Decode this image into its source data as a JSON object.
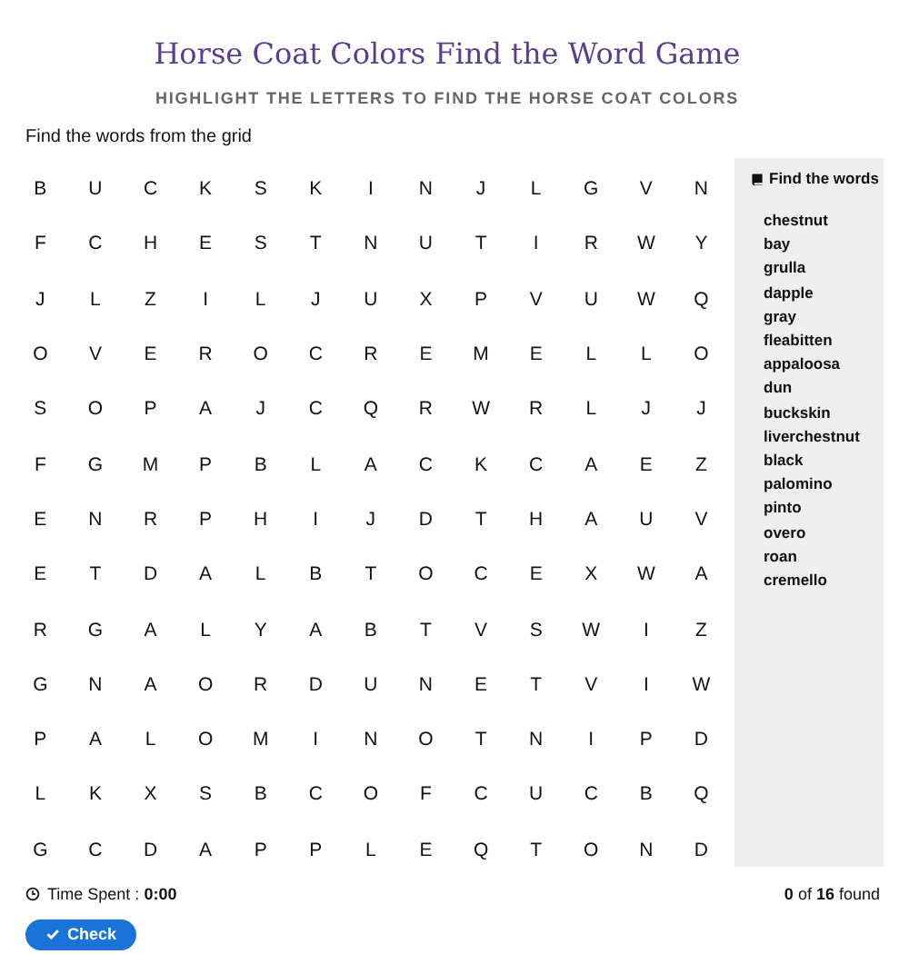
{
  "title": "Horse Coat Colors Find the Word Game",
  "subtitle": "HIGHLIGHT THE LETTERS TO FIND THE HORSE COAT COLORS",
  "instruction": "Find the words from the grid",
  "grid": [
    [
      "B",
      "U",
      "C",
      "K",
      "S",
      "K",
      "I",
      "N",
      "J",
      "L",
      "G",
      "V",
      "N"
    ],
    [
      "F",
      "C",
      "H",
      "E",
      "S",
      "T",
      "N",
      "U",
      "T",
      "I",
      "R",
      "W",
      "Y"
    ],
    [
      "J",
      "L",
      "Z",
      "I",
      "L",
      "J",
      "U",
      "X",
      "P",
      "V",
      "U",
      "W",
      "Q"
    ],
    [
      "O",
      "V",
      "E",
      "R",
      "O",
      "C",
      "R",
      "E",
      "M",
      "E",
      "L",
      "L",
      "O"
    ],
    [
      "S",
      "O",
      "P",
      "A",
      "J",
      "C",
      "Q",
      "R",
      "W",
      "R",
      "L",
      "J",
      "J"
    ],
    [
      "F",
      "G",
      "M",
      "P",
      "B",
      "L",
      "A",
      "C",
      "K",
      "C",
      "A",
      "E",
      "Z"
    ],
    [
      "E",
      "N",
      "R",
      "P",
      "H",
      "I",
      "J",
      "D",
      "T",
      "H",
      "A",
      "U",
      "V"
    ],
    [
      "E",
      "T",
      "D",
      "A",
      "L",
      "B",
      "T",
      "O",
      "C",
      "E",
      "X",
      "W",
      "A"
    ],
    [
      "R",
      "G",
      "A",
      "L",
      "Y",
      "A",
      "B",
      "T",
      "V",
      "S",
      "W",
      "I",
      "Z"
    ],
    [
      "G",
      "N",
      "A",
      "O",
      "R",
      "D",
      "U",
      "N",
      "E",
      "T",
      "V",
      "I",
      "W"
    ],
    [
      "P",
      "A",
      "L",
      "O",
      "M",
      "I",
      "N",
      "O",
      "T",
      "N",
      "I",
      "P",
      "D"
    ],
    [
      "L",
      "K",
      "X",
      "S",
      "B",
      "C",
      "O",
      "F",
      "C",
      "U",
      "C",
      "B",
      "Q"
    ],
    [
      "G",
      "C",
      "D",
      "A",
      "P",
      "P",
      "L",
      "E",
      "Q",
      "T",
      "O",
      "N",
      "D"
    ]
  ],
  "word_list": {
    "heading": "Find the words",
    "words": [
      "chestnut",
      "bay",
      "grulla",
      "dapple",
      "gray",
      "fleabitten",
      "appaloosa",
      "dun",
      "buckskin",
      "liverchestnut",
      "black",
      "palomino",
      "pinto",
      "overo",
      "roan",
      "cremello"
    ]
  },
  "time_spent": "Time Spent : **0:00**",
  "found": "**0** of **16** found",
  "check_button": "Check"
}
